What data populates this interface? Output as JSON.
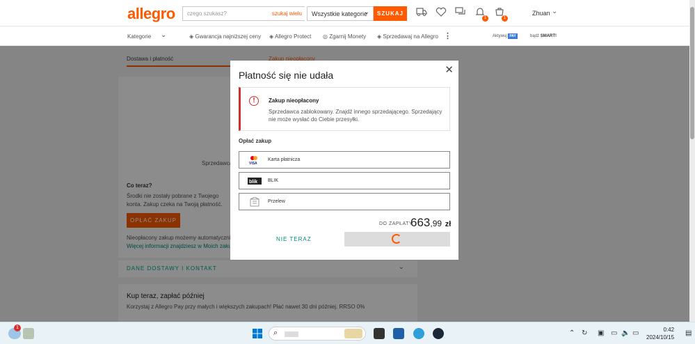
{
  "header": {
    "logo": "allegro",
    "search_placeholder": "czego szukasz?",
    "search_mode": "szukaj wielu",
    "category": "Wszystkie kategorie",
    "search_button": "SZUKAJ",
    "user_name": "Zhuan",
    "notifications_badge": "1",
    "cart_badge": "1"
  },
  "navbar": {
    "categories": "Kategorie",
    "items": [
      "Gwarancja najniższej ceny",
      "Allegro Protect",
      "Zgarnij Monety",
      "Sprzedawaj na Allegro"
    ],
    "active_label": "Aktywuj",
    "pay_label": "PAY",
    "be_label": "bądź",
    "smart_label": "SMART!"
  },
  "steps": {
    "step1": "Dostawa i płatność",
    "step2": "Zakup nieopłacony"
  },
  "page": {
    "seller_partial": "Sprzedawca",
    "what_now": "Co teraz?",
    "what_now_text": "Środki nie zostały pobrane z Twojego konta. Zakup czeka na Twoją płatność.",
    "pay_button": "OPŁAĆ ZAKUP",
    "unpaid_text": "Nieopłacony zakup możemy automatycznie",
    "more_info": "Więcej informacji znajdziesz w",
    "my_purchases": "Moich zakup",
    "delivery": "DANE DOSTAWY I KONTAKT",
    "bnpl_title": "Kup teraz, zapłać później",
    "bnpl_text": "Korzystaj z Allegro Pay przy małych i większych zakupach! Płać nawet 30 dni później. RRSO 0%"
  },
  "modal": {
    "title": "Płatność się nie udała",
    "alert_title": "Zakup nieopłacony",
    "alert_text": "Sprzedawca zablokowany. Znajdź innego sprzedającego. Sprzedający nie może wysłać do Ciebie przesyłki.",
    "pay_label": "Opłać zakup",
    "methods": [
      {
        "label": "Karta płatnicza",
        "icon": "card-icon"
      },
      {
        "label": "BLIK",
        "icon": "blik-icon"
      },
      {
        "label": "Przelew",
        "icon": "transfer-icon"
      }
    ],
    "total_label": "DO ZAPŁATY",
    "total_int": "663",
    "total_dec": ",99",
    "total_currency": "zł",
    "not_now": "NIE TERAZ"
  },
  "taskbar": {
    "weather_badge": "1",
    "time": "0:42",
    "date": "2024/10/15"
  },
  "colors": {
    "accent": "#ff5a00",
    "teal": "#00897b",
    "alert": "#d32f2f"
  }
}
